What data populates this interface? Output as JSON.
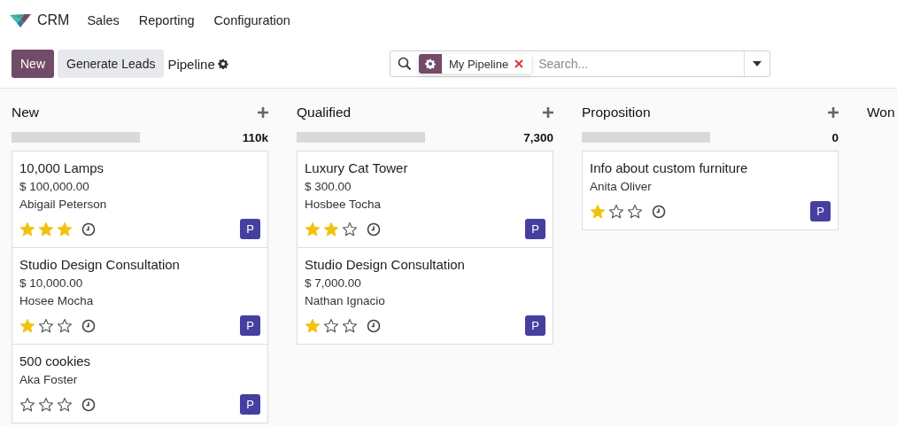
{
  "navbar": {
    "app_name": "CRM",
    "menu": [
      "Sales",
      "Reporting",
      "Configuration"
    ]
  },
  "control_panel": {
    "buttons": [
      {
        "label": "New",
        "kind": "primary"
      },
      {
        "label": "Generate Leads",
        "kind": "secondary"
      }
    ],
    "breadcrumb": "Pipeline",
    "search": {
      "facet": "My Pipeline",
      "placeholder": "Search..."
    }
  },
  "columns": [
    {
      "title": "New",
      "total": "110k",
      "level": 0,
      "cards": [
        {
          "name": "10,000 Lamps",
          "amount": "$ 100,000.00",
          "contact": "Abigail Peterson",
          "stars": 3,
          "avatar": "P"
        },
        {
          "name": "Studio Design Consultation",
          "amount": "$ 10,000.00",
          "contact": "Hosee Mocha",
          "stars": 1,
          "avatar": "P"
        },
        {
          "name": "500 cookies",
          "contact": "Aka Foster",
          "stars": 0,
          "avatar": "P"
        }
      ]
    },
    {
      "title": "Qualified",
      "total": "7,300",
      "level": 0,
      "cards": [
        {
          "name": "Luxury Cat Tower",
          "amount": "$ 300.00",
          "contact": "Hosbee Tocha",
          "stars": 2,
          "avatar": "P"
        },
        {
          "name": "Studio Design Consultation",
          "amount": "$ 7,000.00",
          "contact": "Nathan Ignacio",
          "stars": 1,
          "avatar": "P"
        }
      ]
    },
    {
      "title": "Proposition",
      "total": "0",
      "level": 0,
      "cards": [
        {
          "name": "Info about custom furniture",
          "contact": "Anita Oliver",
          "stars": 1,
          "avatar": "P"
        }
      ]
    },
    {
      "title": "Won"
    }
  ]
}
